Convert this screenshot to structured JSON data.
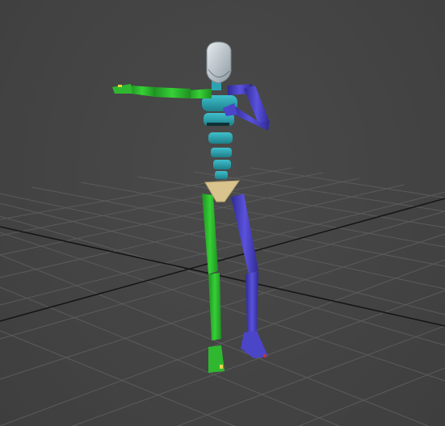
{
  "viewport": {
    "kind": "perspective-3d-viewport",
    "background_color": "#444444",
    "grid_color": "#5a5a5a",
    "axis_line_color": "#111111"
  },
  "biped": {
    "left_side_color": "#2fb82f",
    "right_side_color": "#4b45c8",
    "spine_color": "#2ea3b0",
    "pelvis_color": "#d9c48e",
    "head_color": "#c9d2d8"
  }
}
